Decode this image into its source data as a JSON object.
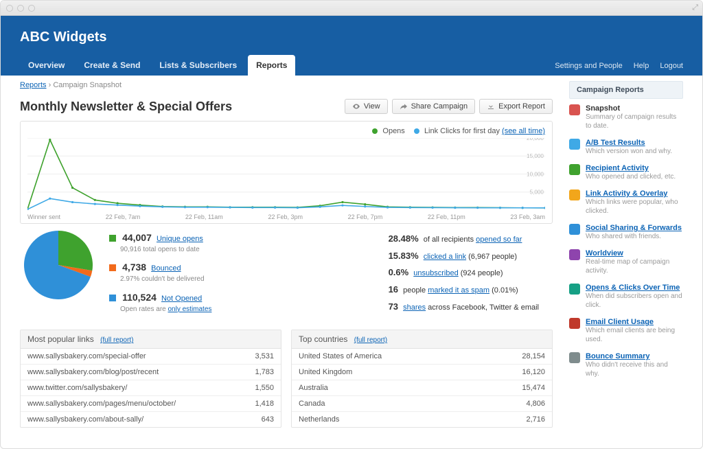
{
  "brand": "ABC Widgets",
  "nav": {
    "tabs": [
      "Overview",
      "Create & Send",
      "Lists & Subscribers",
      "Reports"
    ],
    "active_index": 3,
    "right": [
      "Settings and People",
      "Help",
      "Logout"
    ]
  },
  "breadcrumbs": {
    "root": "Reports",
    "sep": "›",
    "current": "Campaign Snapshot"
  },
  "page_title": "Monthly Newsletter & Special Offers",
  "actions": {
    "view": "View",
    "share": "Share Campaign",
    "export": "Export Report"
  },
  "chart_legend": {
    "opens": "Opens",
    "clicks": "Link Clicks for first day",
    "see_all": "(see all time)"
  },
  "chart_data": {
    "type": "line",
    "xlabel": "",
    "ylabel": "",
    "ylim": [
      0,
      20000
    ],
    "yticks": [
      5000,
      10000,
      15000,
      20000
    ],
    "x_ticks": [
      "Winner sent",
      "22 Feb, 7am",
      "22 Feb, 11am",
      "22 Feb, 3pm",
      "22 Feb, 7pm",
      "22 Feb, 11pm",
      "23 Feb, 3am"
    ],
    "series": [
      {
        "name": "Opens",
        "color": "#3fa22e",
        "values": [
          200,
          19500,
          6200,
          2800,
          1900,
          1400,
          1000,
          900,
          900,
          800,
          800,
          800,
          750,
          1200,
          2200,
          1600,
          900,
          800,
          750,
          700,
          700,
          650,
          620,
          600
        ]
      },
      {
        "name": "Link Clicks for first day",
        "color": "#3fa9e6",
        "values": [
          200,
          3200,
          2200,
          1700,
          1400,
          1100,
          900,
          800,
          800,
          750,
          700,
          700,
          650,
          900,
          1300,
          1000,
          750,
          700,
          680,
          650,
          640,
          630,
          620,
          600
        ]
      }
    ]
  },
  "pie": {
    "segments": [
      {
        "label": "Unique opens",
        "value": 44007,
        "color": "#3fa22e"
      },
      {
        "label": "Bounced",
        "value": 4738,
        "color": "#f26a1b"
      },
      {
        "label": "Not Opened",
        "value": 110524,
        "color": "#2f90d8"
      }
    ],
    "opens_sub": "90,916 total opens to date",
    "bounced_sub": "2.97% couldn't be delivered",
    "notopened_sub_prefix": "Open rates are ",
    "notopened_sub_link": "only estimates"
  },
  "pie_labels": {
    "unique_opens_n": "44,007",
    "unique_opens_l": "Unique opens",
    "bounced_n": "4,738",
    "bounced_l": "Bounced",
    "notopened_n": "110,524",
    "notopened_l": "Not Opened"
  },
  "metrics": [
    {
      "n": "28.48%",
      "t1": "of all recipients ",
      "link": "opened so far",
      "t2": ""
    },
    {
      "n": "15.83%",
      "t1": "",
      "link": "clicked a link",
      "t2": " (6,967 people)"
    },
    {
      "n": "0.6%",
      "t1": "",
      "link": "unsubscribed",
      "t2": " (924 people)"
    },
    {
      "n": "16",
      "t1": "people ",
      "link": "marked it as spam",
      "t2": " (0.01%)"
    },
    {
      "n": "73",
      "t1": "",
      "link": "shares",
      "t2": " across Facebook, Twitter & email"
    }
  ],
  "popular_links": {
    "title": "Most popular links",
    "full": "(full report)",
    "rows": [
      {
        "url": "www.sallysbakery.com/special-offer",
        "n": "3,531"
      },
      {
        "url": "www.sallysbakery.com/blog/post/recent",
        "n": "1,783"
      },
      {
        "url": "www.twitter.com/sallysbakery/",
        "n": "1,550"
      },
      {
        "url": "www.sallysbakery.com/pages/menu/october/",
        "n": "1,418"
      },
      {
        "url": "www.sallysbakery.com/about-sally/",
        "n": "643"
      }
    ]
  },
  "top_countries": {
    "title": "Top countries",
    "full": "(full report)",
    "rows": [
      {
        "c": "United States of America",
        "n": "28,154"
      },
      {
        "c": "United Kingdom",
        "n": "16,120"
      },
      {
        "c": "Australia",
        "n": "15,474"
      },
      {
        "c": "Canada",
        "n": "4,806"
      },
      {
        "c": "Netherlands",
        "n": "2,716"
      }
    ]
  },
  "sidebar": {
    "title": "Campaign Reports",
    "items": [
      {
        "icon": "#d9534f",
        "title": "Snapshot",
        "desc": "Summary of campaign results to date.",
        "no_underline": true
      },
      {
        "icon": "#3fa9e6",
        "title": "A/B Test Results",
        "desc": "Which version won and why."
      },
      {
        "icon": "#3fa22e",
        "title": "Recipient Activity",
        "desc": "Who opened and clicked, etc."
      },
      {
        "icon": "#f2a61b",
        "title": "Link Activity & Overlay",
        "desc": "Which links were popular, who clicked."
      },
      {
        "icon": "#2f90d8",
        "title": "Social Sharing & Forwards",
        "desc": "Who shared with friends."
      },
      {
        "icon": "#8e44ad",
        "title": "Worldview",
        "desc": "Real-time map of campaign activity."
      },
      {
        "icon": "#16a085",
        "title": "Opens & Clicks Over Time",
        "desc": "When did subscribers open and click."
      },
      {
        "icon": "#c0392b",
        "title": "Email Client Usage",
        "desc": "Which email clients are being used."
      },
      {
        "icon": "#7f8c8d",
        "title": "Bounce Summary",
        "desc": "Who didn't receive this and why."
      }
    ]
  }
}
